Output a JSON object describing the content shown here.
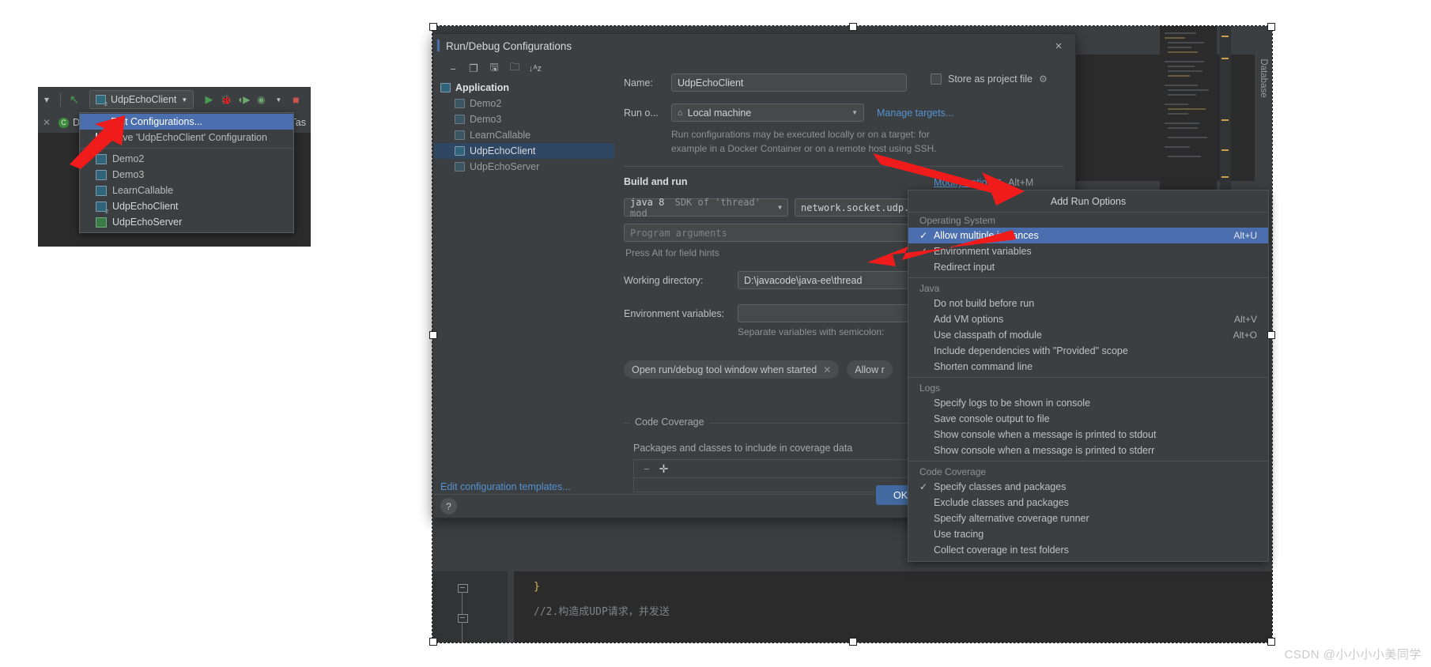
{
  "left_panel": {
    "run_config_name": "UdpEchoClient",
    "debug_tab_label": "D",
    "task_label": "Tas",
    "menu": {
      "items": [
        {
          "label": "Edit Configurations...",
          "icon": "none",
          "selected": true
        },
        {
          "label": "Save 'UdpEchoClient' Configuration",
          "icon": "save-icon",
          "selected": false
        }
      ],
      "configs": [
        {
          "label": "Demo2",
          "icon": "app-config-icon"
        },
        {
          "label": "Demo3",
          "icon": "app-config-icon"
        },
        {
          "label": "LearnCallable",
          "icon": "app-config-icon"
        },
        {
          "label": "UdpEchoClient",
          "icon": "app-config-icon-2"
        },
        {
          "label": "UdpEchoServer",
          "icon": "app-config-icon"
        }
      ]
    },
    "toolbar_icons": [
      "chevron-down-icon",
      "build-hammer-icon",
      "run-icon",
      "debug-icon",
      "run-coverage-icon",
      "profile-icon",
      "stop-icon"
    ]
  },
  "dialog": {
    "title": "Run/Debug Configurations",
    "close_label": "×",
    "toolbar_icons": [
      "remove-icon",
      "copy-icon",
      "save-icon",
      "folder-add-icon",
      "sort-icon"
    ],
    "tree": {
      "root": "Application",
      "items": [
        {
          "label": "Demo2",
          "selected": false
        },
        {
          "label": "Demo3",
          "selected": false
        },
        {
          "label": "LearnCallable",
          "selected": false
        },
        {
          "label": "UdpEchoClient",
          "selected": true
        },
        {
          "label": "UdpEchoServer",
          "selected": false
        }
      ]
    },
    "edit_templates_link": "Edit configuration templates...",
    "name_label": "Name:",
    "name_value": "UdpEchoClient",
    "store_as_project_file_label": "Store as project file",
    "run_on_label": "Run o...",
    "run_on_value": "Local machine",
    "manage_targets_link": "Manage targets...",
    "run_on_help_line1": "Run configurations may be executed locally or on a target: for",
    "run_on_help_line2": "example in a Docker Container or on a remote host using SSH.",
    "build_and_run_header": "Build and run",
    "jdk_value_prefix": "java 8",
    "jdk_value_suffix": "SDK of 'thread' mod",
    "main_class_value": "network.socket.udp.",
    "modify_options_link": "Modify options",
    "modify_options_shortcut": "Alt+M",
    "program_arguments_placeholder": "Program arguments",
    "field_hints": "Press Alt for field hints",
    "working_directory_label": "Working directory:",
    "working_directory_value": "D:\\javacode\\java-ee\\thread",
    "environment_variables_label": "Environment variables:",
    "environment_variables_value": "",
    "separate_variables_hint": "Separate variables with semicolon:",
    "chip_open_tool_window": "Open run/debug tool window when started",
    "chip_allow": "Allow r",
    "code_coverage_legend": "Code Coverage",
    "coverage_hint": "Packages and classes to include in coverage data",
    "coverage_buttons": [
      "remove-icon",
      "add-icon"
    ],
    "help_button": "?",
    "ok_button": "OK"
  },
  "options_menu": {
    "header": "Add Run Options",
    "groups": [
      {
        "label": "Operating System",
        "items": [
          {
            "label": "Allow multiple instances",
            "checked": true,
            "selected": true,
            "shortcut": "Alt+U"
          },
          {
            "label": "Environment variables",
            "checked": true,
            "selected": false,
            "shortcut": ""
          },
          {
            "label": "Redirect input",
            "checked": false,
            "selected": false,
            "shortcut": ""
          }
        ]
      },
      {
        "label": "Java",
        "items": [
          {
            "label": "Do not build before run",
            "checked": false,
            "selected": false,
            "shortcut": ""
          },
          {
            "label": "Add VM options",
            "checked": false,
            "selected": false,
            "shortcut": "Alt+V"
          },
          {
            "label": "Use classpath of module",
            "checked": false,
            "selected": false,
            "shortcut": "Alt+O"
          },
          {
            "label": "Include dependencies with \"Provided\" scope",
            "checked": false,
            "selected": false,
            "shortcut": ""
          },
          {
            "label": "Shorten command line",
            "checked": false,
            "selected": false,
            "shortcut": ""
          }
        ]
      },
      {
        "label": "Logs",
        "items": [
          {
            "label": "Specify logs to be shown in console",
            "checked": false,
            "selected": false,
            "shortcut": ""
          },
          {
            "label": "Save console output to file",
            "checked": false,
            "selected": false,
            "shortcut": ""
          },
          {
            "label": "Show console when a message is printed to stdout",
            "checked": false,
            "selected": false,
            "shortcut": ""
          },
          {
            "label": "Show console when a message is printed to stderr",
            "checked": false,
            "selected": false,
            "shortcut": ""
          }
        ]
      },
      {
        "label": "Code Coverage",
        "items": [
          {
            "label": "Specify classes and packages",
            "checked": true,
            "selected": false,
            "shortcut": ""
          },
          {
            "label": "Exclude classes and packages",
            "checked": false,
            "selected": false,
            "shortcut": ""
          },
          {
            "label": "Specify alternative coverage runner",
            "checked": false,
            "selected": false,
            "shortcut": ""
          },
          {
            "label": "Use tracing",
            "checked": false,
            "selected": false,
            "shortcut": ""
          },
          {
            "label": "Collect coverage in test folders",
            "checked": false,
            "selected": false,
            "shortcut": ""
          }
        ]
      }
    ]
  },
  "editor": {
    "line_brace": "}",
    "line_comment": "//2.构造成UDP请求，并发送",
    "database_tab": "Database"
  },
  "watermark": "CSDN @小小小小美同学",
  "colors": {
    "selection_blue": "#4b6eaf",
    "tree_selection": "#2f4763",
    "link_blue": "#5591d1",
    "ok_button": "#4269a0",
    "arrow_red": "#f01c1c",
    "panel_bg": "#3c3f41",
    "editor_bg": "#2b2b2b"
  }
}
